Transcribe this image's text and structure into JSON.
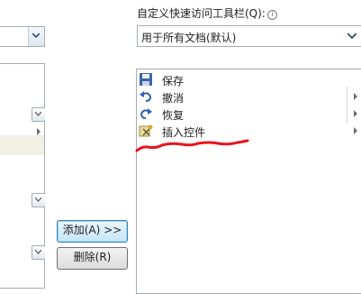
{
  "quick_access": {
    "label": "自定义快速访问工具栏(Q):",
    "info_icon": "i",
    "combo_value": "用于所有文档(默认)",
    "items": [
      {
        "label": "保存",
        "icon": "save-icon",
        "has_arrow": false
      },
      {
        "label": "撤消",
        "icon": "undo-icon",
        "has_arrow": true
      },
      {
        "label": "恢复",
        "icon": "redo-icon",
        "has_arrow": true
      },
      {
        "label": "插入控件",
        "icon": "insert-control-icon",
        "has_arrow": true
      }
    ]
  },
  "buttons": {
    "add_label": "添加(A) >>",
    "remove_label": "删除(R)"
  },
  "annotation": {
    "color": "#e8141e"
  },
  "colors": {
    "border": "#a5acb5",
    "accent": "#3c7fb1"
  }
}
